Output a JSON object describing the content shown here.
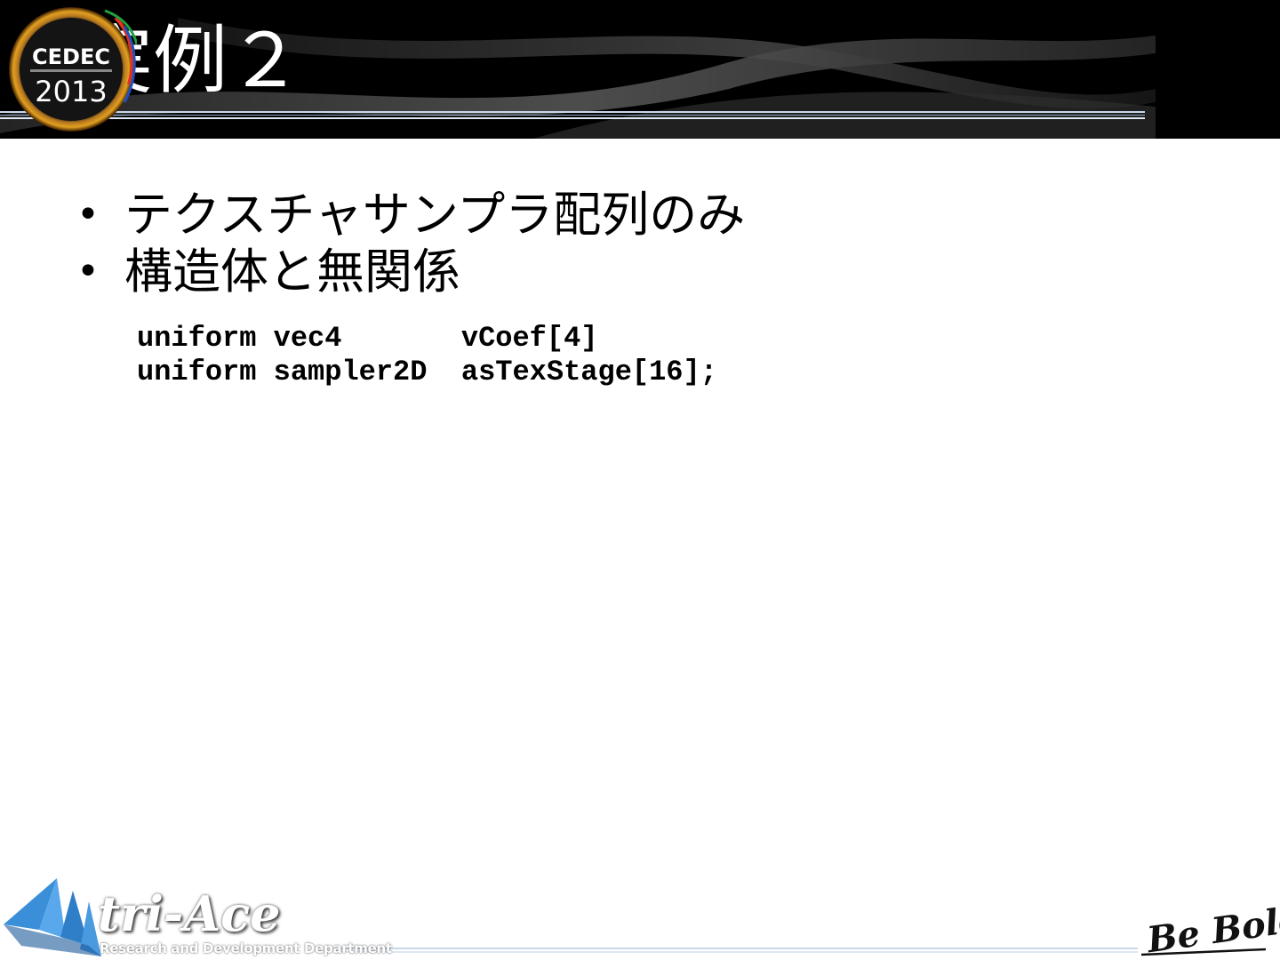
{
  "slide": {
    "title": "実例２",
    "bullets": [
      "テクスチャサンプラ配列のみ",
      "構造体と無関係"
    ],
    "bullet_glyph": "•",
    "code_lines": [
      "uniform vec4       vCoef[4]",
      "uniform sampler2D  asTexStage[16];"
    ]
  },
  "header_logo": {
    "line1": "CEDEC",
    "line2": "2013"
  },
  "footer": {
    "brand": "tri-Ace",
    "brand_sub": "Research and Development Department",
    "motto": "Be Bold!"
  },
  "colors": {
    "header_bg": "#000000",
    "title_text": "#ffffff",
    "body_text": "#000000",
    "accent_blue": "#3a8fd8",
    "footer_line": "#b8cfe6"
  }
}
